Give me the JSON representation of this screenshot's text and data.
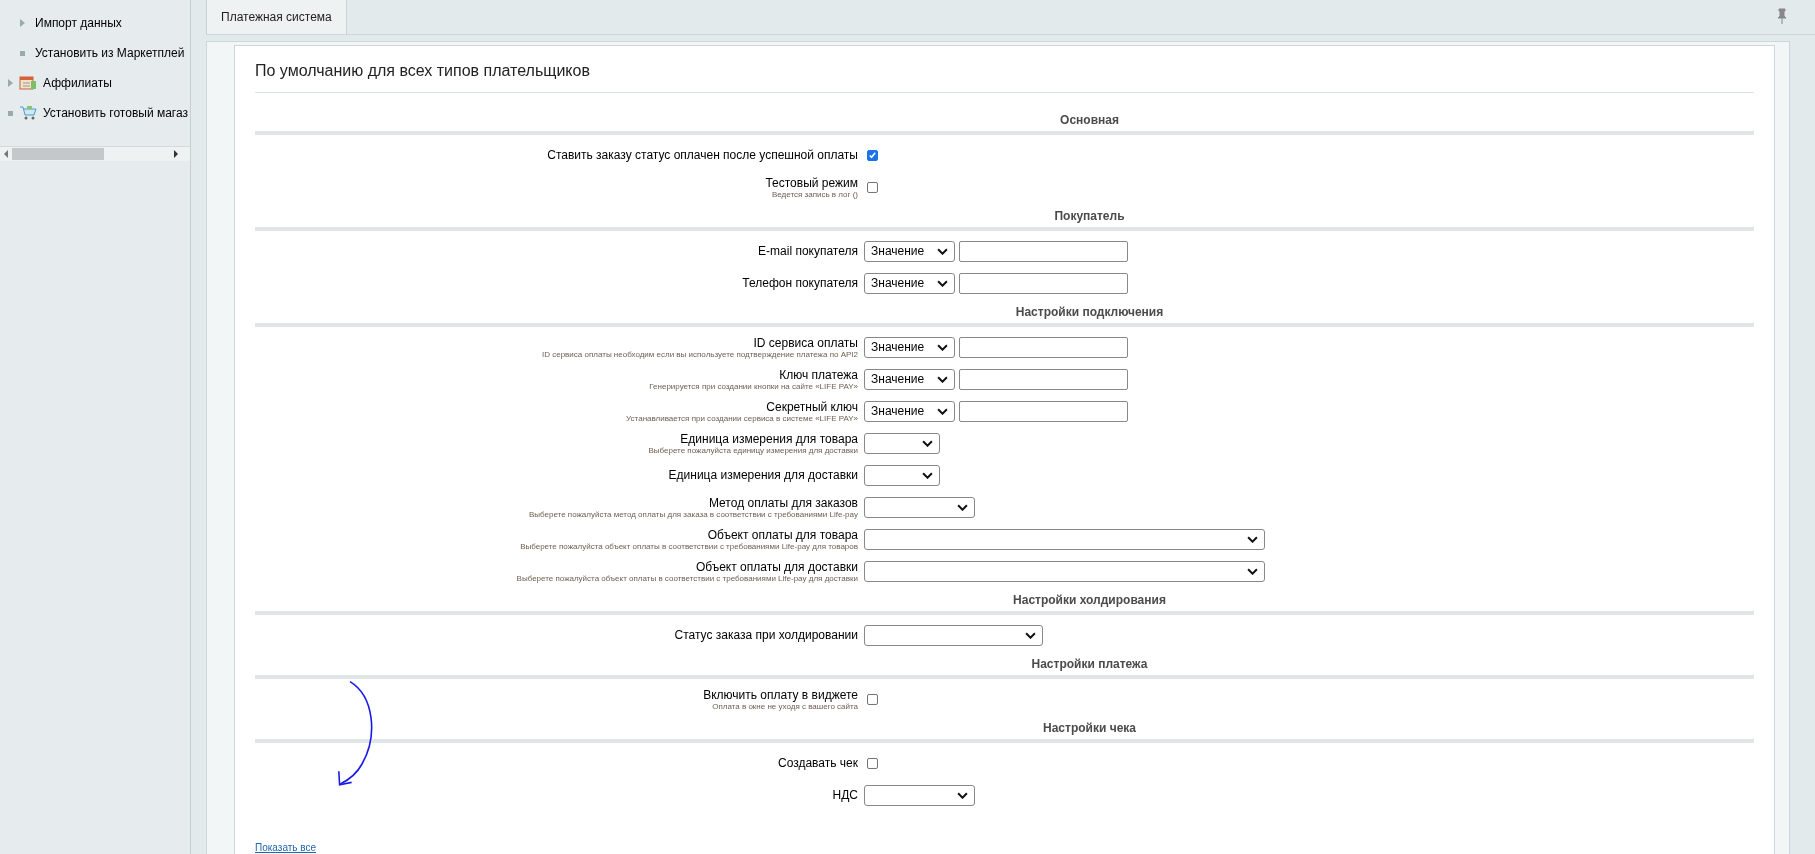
{
  "sidebar": {
    "sub_items": [
      {
        "label": "Импорт данных",
        "kind": "arrow"
      },
      {
        "label": "Установить из Маркетплей",
        "kind": "bullet"
      }
    ],
    "items": [
      {
        "label": "Аффилиаты",
        "kind": "arrow"
      },
      {
        "label": "Установить готовый магаз",
        "kind": "bullet"
      }
    ]
  },
  "tabs": [
    {
      "label": "Платежная система",
      "selected": true
    }
  ],
  "panel": {
    "title": "По умолчанию для всех типов плательщиков",
    "sections": [
      {
        "title": "Основная",
        "rows": [
          {
            "label": "Ставить заказу статус оплачен после успешной оплаты",
            "kind": "checkbox",
            "checked": true
          },
          {
            "label": "Тестовый режим",
            "hint": "Ведется запись в лог ()",
            "kind": "checkbox",
            "checked": false
          }
        ]
      },
      {
        "title": "Покупатель",
        "rows": [
          {
            "label": "E-mail покупателя",
            "kind": "source",
            "value": "Значение"
          },
          {
            "label": "Телефон покупателя",
            "kind": "source",
            "value": "Значение"
          }
        ]
      },
      {
        "title": "Настройки подключения",
        "rows": [
          {
            "label": "ID сервиса оплаты",
            "hint": "ID сервиса оплаты необходим если вы используете подтверждение платежа по API2",
            "kind": "source",
            "value": "Значение"
          },
          {
            "label": "Ключ платежа",
            "hint": "Генерируется при создании кнопки на сайте «LIFE PAY»",
            "kind": "source",
            "value": "Значение"
          },
          {
            "label": "Секретный ключ",
            "hint": "Устанавливается при создании сервиса в системе «LIFE PAY»",
            "kind": "source",
            "value": "Значение"
          },
          {
            "label": "Единица измерения для товара",
            "hint": "Выберете пожалуйста единицу измерения для доставки",
            "kind": "narrow"
          },
          {
            "label": "Единица измерения для доставки",
            "kind": "narrow"
          },
          {
            "label": "Метод оплаты для заказов",
            "hint": "Выберете пожалуйста метод оплаты для заказа в соответствии с требованиями Life-pay",
            "kind": "medium"
          },
          {
            "label": "Объект оплаты для товара",
            "hint": "Выберете пожалуйста объект оплаты в соответствии с требованиями Life-pay для товаров",
            "kind": "wide"
          },
          {
            "label": "Объект оплаты для доставки",
            "hint": "Выберете пожалуйста объект оплаты в соответствии с требованиями Life-pay для доставки",
            "kind": "wide"
          }
        ]
      },
      {
        "title": "Настройки холдирования",
        "rows": [
          {
            "label": "Статус заказа при холдировании",
            "kind": "large"
          }
        ]
      },
      {
        "title": "Настройки платежа",
        "rows": [
          {
            "label": "Включить оплату в виджете",
            "hint": "Оплата в окне не уходя с вашего сайта",
            "kind": "checkbox",
            "checked": false
          }
        ]
      },
      {
        "title": "Настройки чека",
        "rows": [
          {
            "label": "Создавать чек",
            "kind": "checkbox",
            "checked": false
          },
          {
            "label": "НДС",
            "kind": "medium"
          }
        ]
      }
    ],
    "link": "Показать все"
  }
}
